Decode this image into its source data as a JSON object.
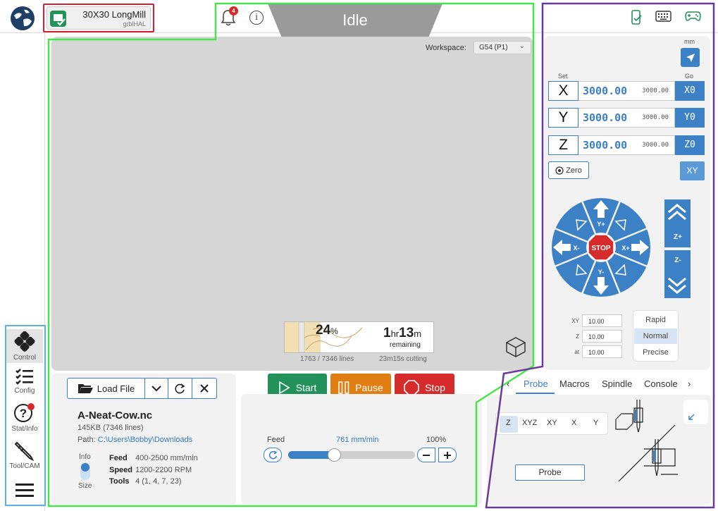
{
  "header": {
    "machine_name": "30X30 LongMill",
    "firmware": "grblHAL",
    "notification_count": "4",
    "info_icon": "i",
    "state": "Idle",
    "icons": [
      "phone-icon",
      "keyboard-icon",
      "gamepad-icon"
    ],
    "colors": {
      "state_bg": "#9a9a9a",
      "accent": "#3c80c5",
      "connected": "#23925a"
    }
  },
  "sidebar": {
    "items": [
      {
        "label": "Control",
        "icon": "control-icon"
      },
      {
        "label": "Config",
        "icon": "config-icon"
      },
      {
        "label": "Stat/Info",
        "icon": "help-icon"
      },
      {
        "label": "Tool/CAM",
        "icon": "tool-icon"
      },
      {
        "label": "",
        "icon": "menu-icon"
      }
    ]
  },
  "visualizer": {
    "workspace_label": "Workspace:",
    "workspace_value": "G54 (P1)",
    "progress_percent_value": "24",
    "progress_percent_unit": "%",
    "progress_fraction": 0.24,
    "remaining_hr": "1",
    "remaining_hr_unit": "hr",
    "remaining_min": "13",
    "remaining_min_unit": "m",
    "remaining_label": "remaining",
    "lines": "1763 / 7346 lines",
    "cutting": "23m15s cutting"
  },
  "file": {
    "load_label": "Load File",
    "name": "A-Neat-Cow.nc",
    "size": "145KB (7346 lines)",
    "path_label": "Path: ",
    "path": "C:\\Users\\Bobby\\Downloads",
    "info_label": "Info",
    "size_label": "Size",
    "feed_key": "Feed",
    "feed_val": "400-2500 mm/min",
    "speed_key": "Speed",
    "speed_val": "1200-2200 RPM",
    "tools_key": "Tools",
    "tools_val": "4 (1, 4, 7, 23)"
  },
  "run": {
    "start": "Start",
    "pause": "Pause",
    "stop": "Stop"
  },
  "override": {
    "label": "Feed",
    "value": "761 mm/min",
    "percent": "100%",
    "fraction": 0.37
  },
  "dro": {
    "unit": "mm",
    "set_label": "Set",
    "go_label": "Go",
    "axes": [
      {
        "letter": "X",
        "work": "3000.00",
        "machine": "3000.00",
        "zero": "X0"
      },
      {
        "letter": "Y",
        "work": "3000.00",
        "machine": "3000.00",
        "zero": "Y0"
      },
      {
        "letter": "Z",
        "work": "3000.00",
        "machine": "3000.00",
        "zero": "Z0"
      }
    ],
    "zero_all": "Zero",
    "goto_xy": "XY"
  },
  "jog": {
    "stop": "STOP",
    "y_plus": "Y+",
    "y_minus": "Y-",
    "x_plus": "X+",
    "x_minus": "X-",
    "z_plus": "Z+",
    "z_minus": "Z-",
    "steps": [
      {
        "label": "XY",
        "value": "10.00"
      },
      {
        "label": "Z",
        "value": "10.00"
      },
      {
        "label": "at",
        "value": "10.00"
      }
    ],
    "speeds": [
      "Rapid",
      "Normal",
      "Precise"
    ],
    "selected_speed": "Normal"
  },
  "tools_tabs": {
    "tabs": [
      "Probe",
      "Macros",
      "Spindle",
      "Console"
    ],
    "active": "Probe",
    "probe_axes": [
      "Z",
      "XYZ",
      "XY",
      "X",
      "Y"
    ],
    "selected_axis": "Z",
    "probe_button": "Probe"
  }
}
